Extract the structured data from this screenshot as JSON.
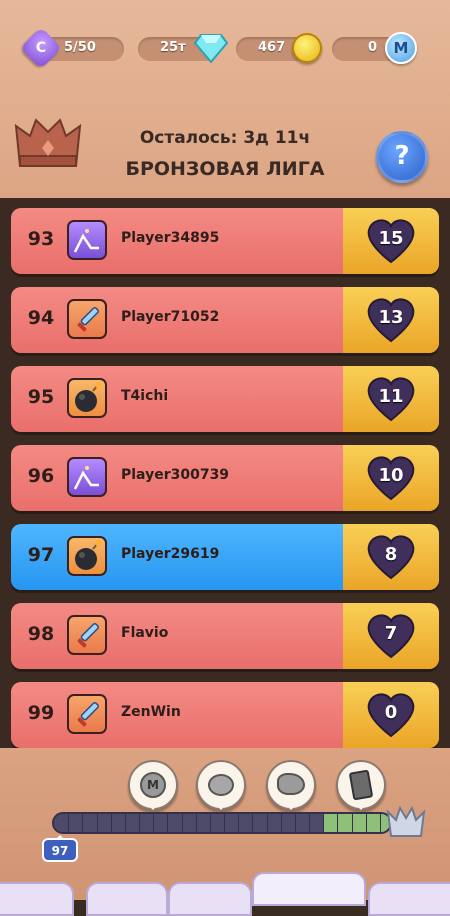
{
  "resources": {
    "energy": {
      "icon": "c-token-icon",
      "value": "5/50"
    },
    "gems": {
      "icon": "diamond-icon",
      "value": "25т"
    },
    "coins": {
      "icon": "gold-coin-icon",
      "value": "467"
    },
    "m_tokens": {
      "icon": "m-token-icon",
      "value": "0"
    }
  },
  "league": {
    "time_left": "Осталось: 3д 11ч",
    "name": "БРОНЗОВАЯ ЛИГА",
    "help_label": "?"
  },
  "leaderboard": [
    {
      "rank": "93",
      "name": "Player34895",
      "avatar": "crossbow-icon",
      "score": "15",
      "me": false
    },
    {
      "rank": "94",
      "name": "Player71052",
      "avatar": "sword-icon",
      "score": "13",
      "me": false
    },
    {
      "rank": "95",
      "name": "T4ichi",
      "avatar": "bomb-icon",
      "score": "11",
      "me": false
    },
    {
      "rank": "96",
      "name": "Player300739",
      "avatar": "crossbow-icon",
      "score": "10",
      "me": false
    },
    {
      "rank": "97",
      "name": "Player29619",
      "avatar": "bomb-icon",
      "score": "8",
      "me": true
    },
    {
      "rank": "98",
      "name": "Flavio",
      "avatar": "sword-icon",
      "score": "7",
      "me": false
    },
    {
      "rank": "99",
      "name": "ZenWin",
      "avatar": "sword-icon",
      "score": "0",
      "me": false
    }
  ],
  "progress": {
    "current_rank_marker": "97",
    "rewards": [
      "m-token-stack-icon",
      "silver-coins-icon",
      "ore-icon",
      "card-pack-icon"
    ],
    "fill_fraction": 0.8
  },
  "colors": {
    "row": "#ee7b76",
    "me_row": "#3aa6f8",
    "gold_tab": "#f2ba3c",
    "heart": "#3f2f5a"
  }
}
